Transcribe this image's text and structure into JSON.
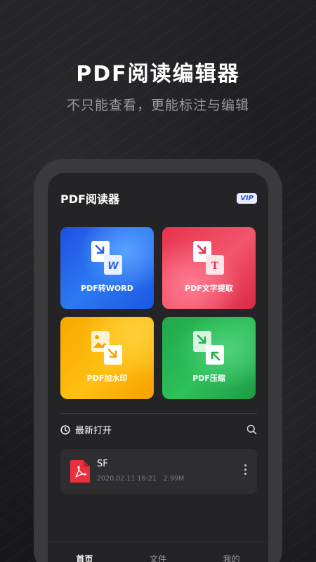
{
  "hero": {
    "title": "PDF阅读编辑器",
    "subtitle": "不只能查看，更能标注与编辑"
  },
  "app": {
    "title": "PDF阅读器",
    "vip_badge": "VIP"
  },
  "tools": [
    {
      "label": "PDF转WORD",
      "icon": "pdf-to-word-icon",
      "color": "#2466ea"
    },
    {
      "label": "PDF文字提取",
      "icon": "text-extract-icon",
      "color": "#ec3f58"
    },
    {
      "label": "PDF加水印",
      "icon": "watermark-icon",
      "color": "#fbb20a"
    },
    {
      "label": "PDF压缩",
      "icon": "compress-icon",
      "color": "#27b352"
    }
  ],
  "recent": {
    "title": "最新打开",
    "files": [
      {
        "name": "SF",
        "date": "2020.02.11 16:21",
        "size": "2.99M"
      }
    ]
  },
  "tabs": [
    {
      "label": "首页",
      "active": true
    },
    {
      "label": "文件",
      "active": false
    },
    {
      "label": "我的",
      "active": false
    }
  ]
}
